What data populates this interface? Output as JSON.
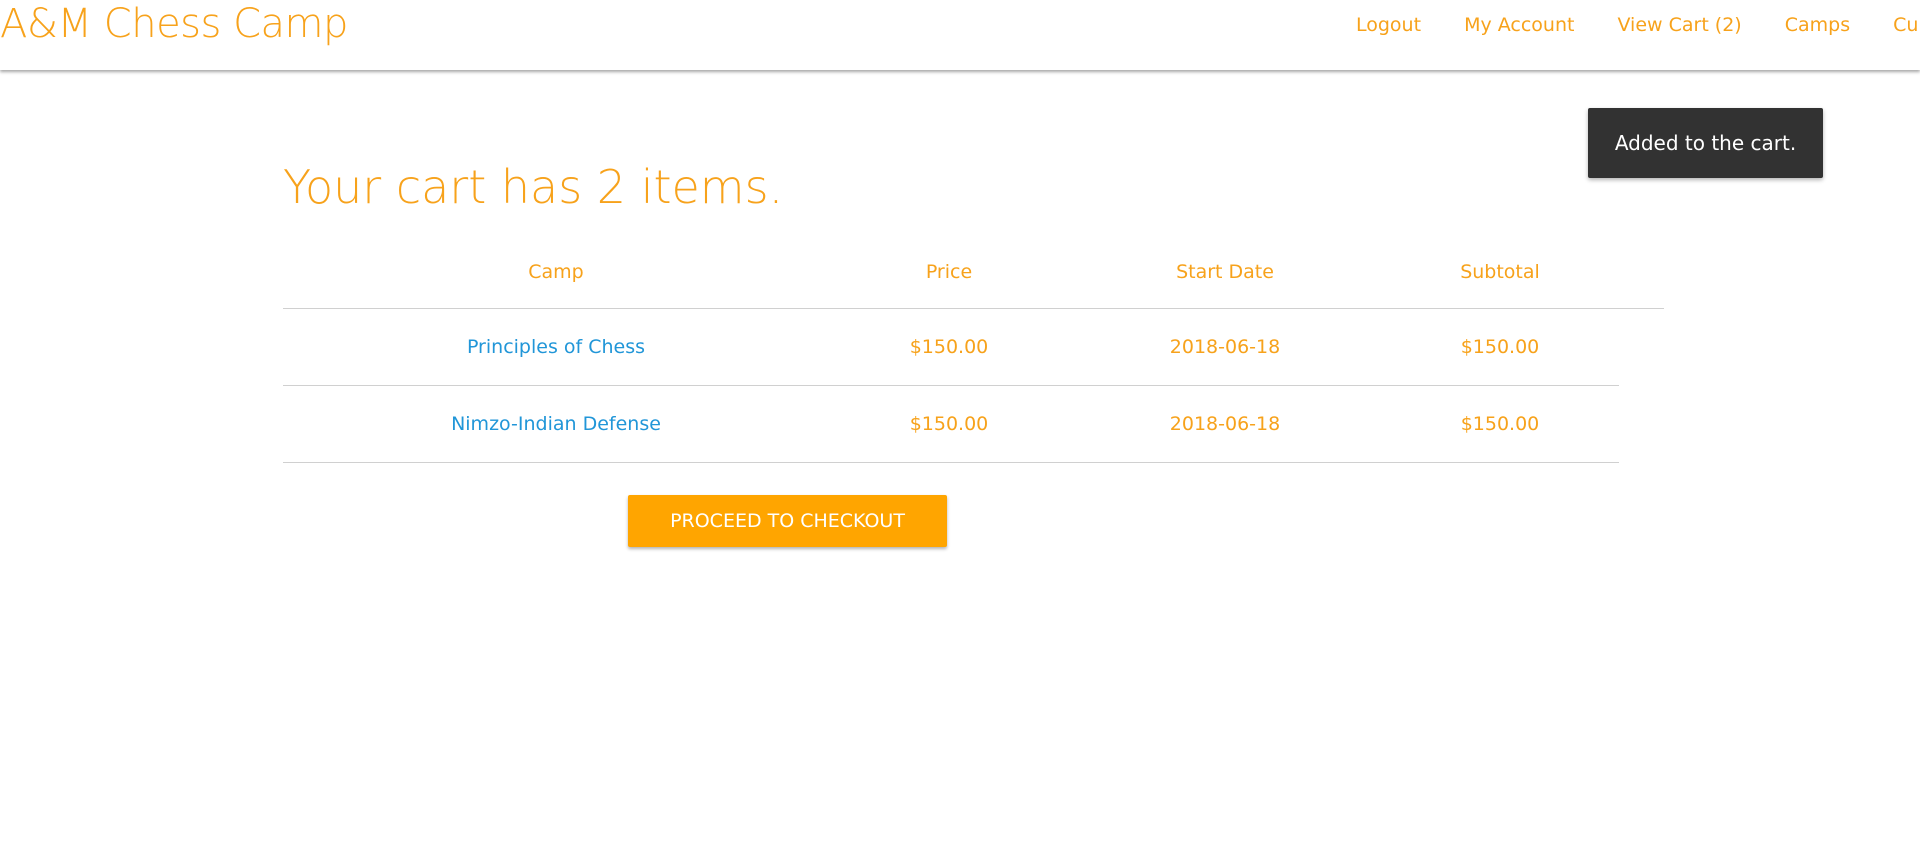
{
  "navbar": {
    "brand": "A&M Chess Camp",
    "links": [
      {
        "label": "Logout"
      },
      {
        "label": "My Account"
      },
      {
        "label": "View Cart (2)"
      },
      {
        "label": "Camps"
      },
      {
        "label": "Curriculu"
      }
    ]
  },
  "toast": {
    "message": "Added to the cart."
  },
  "cart": {
    "title": "Your cart has 2 items.",
    "columns": {
      "camp": "Camp",
      "price": "Price",
      "start_date": "Start Date",
      "subtotal": "Subtotal"
    },
    "rows": [
      {
        "camp": "Principles of Chess",
        "price": "$150.00",
        "start_date": "2018-06-18",
        "subtotal": "$150.00"
      },
      {
        "camp": "Nimzo-Indian Defense",
        "price": "$150.00",
        "start_date": "2018-06-18",
        "subtotal": "$150.00"
      }
    ],
    "checkout_label": "PROCEED TO CHECKOUT"
  },
  "colors": {
    "accent": "#f7a21b",
    "link": "#2196d8",
    "button": "#ffa500",
    "toast_bg": "#323232"
  }
}
